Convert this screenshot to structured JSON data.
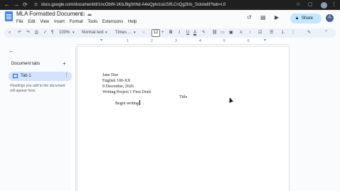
{
  "browser": {
    "url": "docs.google.com/document/d/1ncObW-1KbJ9g0rthd-A4eQptvzuicSIfLCnQg2hls_Sck/edit?tab=t.0",
    "back_icon": "arrow-left-icon",
    "forward_icon": "arrow-right-icon",
    "reload_icon": "reload-icon"
  },
  "header": {
    "doc_title": "MLA Formatted Document",
    "menu": [
      "File",
      "Edit",
      "View",
      "Insert",
      "Format",
      "Tools",
      "Extensions",
      "Help"
    ],
    "share_label": "Share",
    "user_initial": "A",
    "accent": "#c2e7ff"
  },
  "toolbar": {
    "zoom": "100%",
    "style": "Normal text",
    "font": "Times ...",
    "font_size": "12",
    "bold": "B",
    "italic": "I",
    "underline": "U",
    "text_color_icon": "A"
  },
  "ruler": {
    "ticks": [
      "1",
      "2",
      "3",
      "4",
      "5",
      "6"
    ]
  },
  "side_panel": {
    "title": "Document tabs",
    "tab_label": "Tab 1",
    "hint": "Headings you add to the document will appear here."
  },
  "document": {
    "lines": [
      "Jane Doe",
      "English 100-XX",
      "8 December, 2026",
      "Writing Project 1 First Draft"
    ],
    "title": "Title",
    "body": "Begin writing"
  }
}
